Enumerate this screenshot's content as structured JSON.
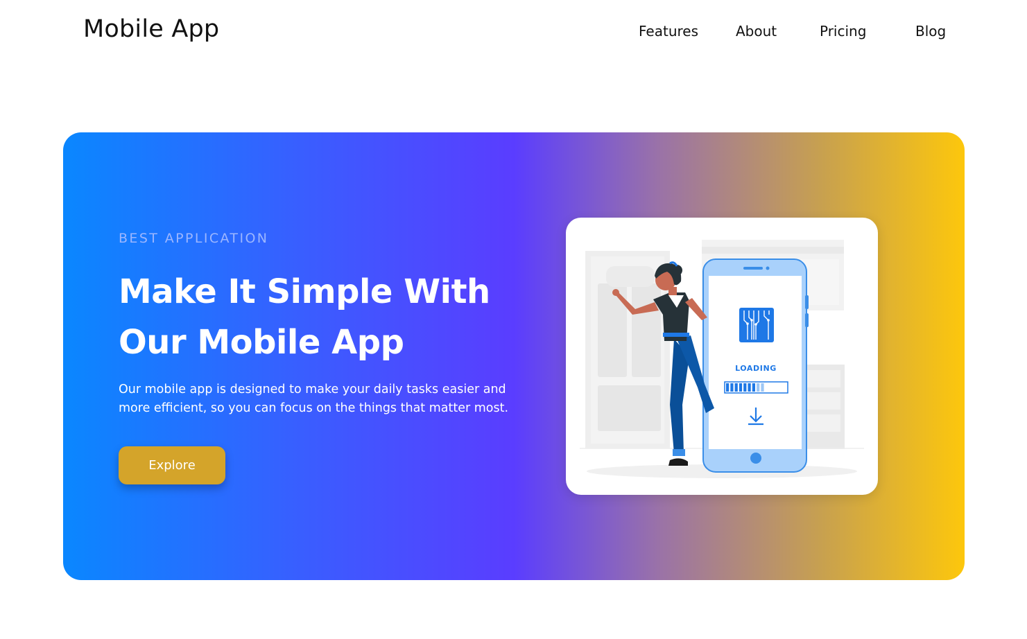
{
  "header": {
    "logo": "Mobile App",
    "nav": [
      {
        "label": "Features"
      },
      {
        "label": "About"
      },
      {
        "label": "Pricing"
      },
      {
        "label": "Blog"
      }
    ]
  },
  "hero": {
    "eyebrow": "BEST APPLICATION",
    "headline_line1": "Make It Simple With",
    "headline_line2": "Our Mobile App",
    "description": "Our mobile app is designed to make your daily tasks easier and more efficient, so you can focus on the things that matter most.",
    "cta_label": "Explore",
    "illustration": {
      "loading_text": "LOADING",
      "loading_progress": 0.5
    }
  },
  "colors": {
    "gradient_start": "#0a87ff",
    "gradient_mid": "#5a3dff",
    "gradient_end": "#fdc70c",
    "cta": "#d4a42a",
    "accent_blue": "#1e78e6"
  }
}
